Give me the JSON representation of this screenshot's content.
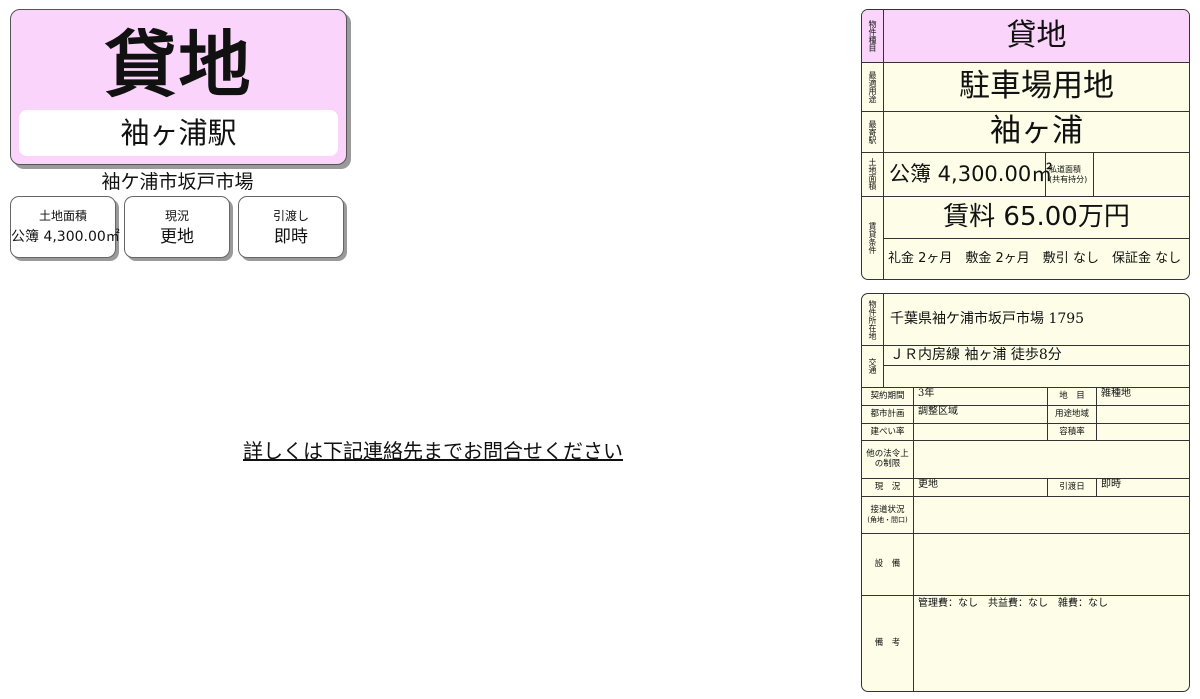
{
  "title_card": {
    "type": "貸地",
    "station": "袖ヶ浦駅"
  },
  "address_short": "袖ケ浦市坂戸市場",
  "summary_cards": [
    {
      "label": "土地面積",
      "value": "公簿 4,300.00㎡"
    },
    {
      "label": "現況",
      "value": "更地"
    },
    {
      "label": "引渡し",
      "value": "即時"
    }
  ],
  "inquiry_text": "詳しくは下記連絡先までお問合せください",
  "panel1": {
    "type_label": "物件種目",
    "type_value": "貸地",
    "use_label": "最適用途",
    "use_value": "駐車場用地",
    "station_label": "最寄駅",
    "station_value": "袖ヶ浦",
    "area_label": "土地面積",
    "area_value": "公簿 4,300.00㎡",
    "private_road_label": "私道面積(共有持分)",
    "private_road_value": "",
    "lease_label": "賃貸条件",
    "rent_value": "賃料 65.00万円",
    "conditions": "礼金 2ヶ月　敷金 2ヶ月　敷引 なし　保証金 なし"
  },
  "panel2": {
    "location_label": "物件所在地",
    "location_value": "千葉県袖ケ浦市坂戸市場 1795",
    "transport_label": "交通",
    "transport_value": "ＪＲ内房線 袖ヶ浦 徒歩8分",
    "contract_label": "契約期間",
    "contract_value": "3年",
    "land_cat_label": "地　目",
    "land_cat_value": "雑種地",
    "city_plan_label": "都市計画",
    "city_plan_value": "調整区域",
    "zoning_label": "用途地域",
    "zoning_value": "",
    "coverage_label": "建ぺい率",
    "coverage_value": "",
    "far_label": "容積率",
    "far_value": "",
    "other_law_label": "他の法令上の制限",
    "other_law_value": "",
    "status_label": "現　況",
    "status_value": "更地",
    "handover_label": "引渡日",
    "handover_value": "即時",
    "road_label": "接道状況",
    "road_sub_label": "(角地・間口)",
    "road_value": "",
    "facility_label": "設　備",
    "facility_value": "",
    "remarks_label": "備　考",
    "remarks_value": "管理費：なし　共益費：なし　雑費：なし"
  }
}
